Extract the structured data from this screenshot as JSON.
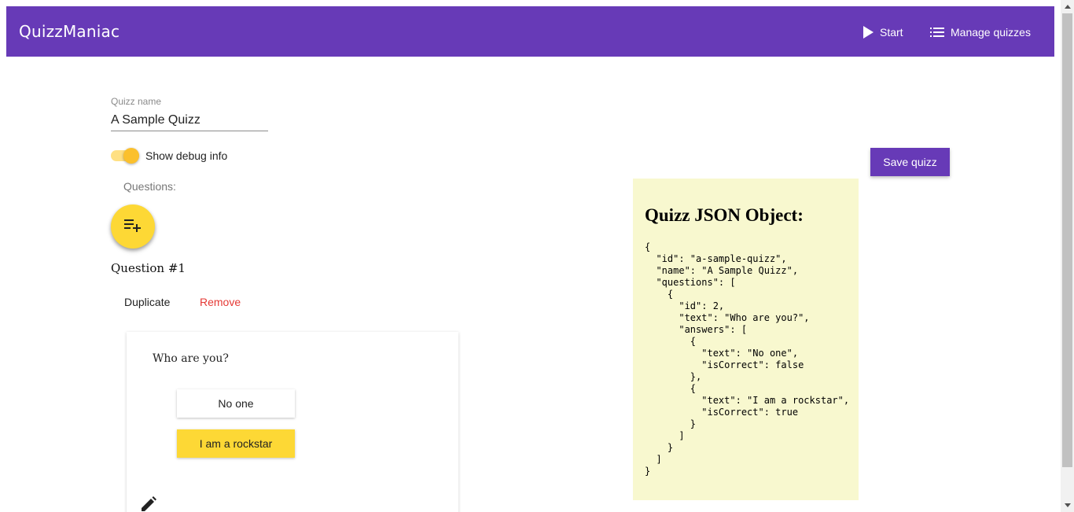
{
  "toolbar": {
    "title": "QuizzManiac",
    "start_label": "Start",
    "manage_label": "Manage quizzes",
    "background_color": "#673ab7"
  },
  "form": {
    "name_label": "Quizz name",
    "name_value": "A Sample Quizz",
    "debug_toggle_label": "Show debug info",
    "debug_toggle_on": true,
    "questions_label": "Questions:",
    "add_question_icon": "playlist-add-icon"
  },
  "question": {
    "title": "Question #1",
    "duplicate_label": "Duplicate",
    "remove_label": "Remove",
    "text": "Who are you?",
    "answers": [
      {
        "text": "No one",
        "is_correct": false
      },
      {
        "text": "I am a rockstar",
        "is_correct": true
      }
    ],
    "edit_icon": "pencil-icon"
  },
  "save_button": {
    "label": "Save quizz"
  },
  "json_panel": {
    "heading": "Quizz JSON Object:",
    "content": "{\n  \"id\": \"a-sample-quizz\",\n  \"name\": \"A Sample Quizz\",\n  \"questions\": [\n    {\n      \"id\": 2,\n      \"text\": \"Who are you?\",\n      \"answers\": [\n        {\n          \"text\": \"No one\",\n          \"isCorrect\": false\n        },\n        {\n          \"text\": \"I am a rockstar\",\n          \"isCorrect\": true\n        }\n      ]\n    }\n  ]\n}",
    "background_color": "#f8f8cf"
  },
  "colors": {
    "accent_yellow": "#fdd835",
    "remove_red": "#e53935"
  }
}
